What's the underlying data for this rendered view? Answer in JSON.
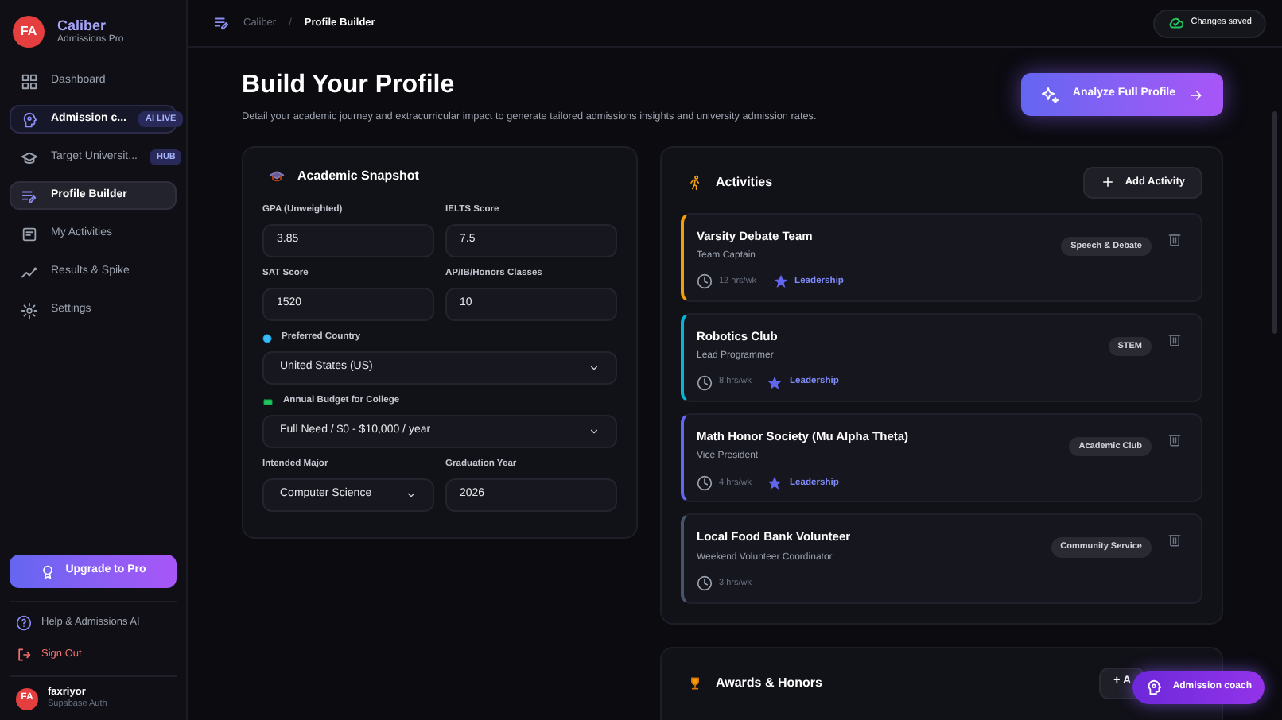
{
  "sidebar": {
    "brand": {
      "avatar": "FA",
      "name": "Caliber",
      "subtitle": "Admissions Pro"
    },
    "items": [
      {
        "label": "Dashboard",
        "selected": false,
        "highlighted": false
      },
      {
        "label": "Admission c...",
        "badge": "AI LIVE",
        "selected": false,
        "highlighted": true
      },
      {
        "label": "Target Universit...",
        "badge": "HUB",
        "selected": false,
        "highlighted": false
      },
      {
        "label": "Profile Builder",
        "selected": true,
        "highlighted": false
      },
      {
        "label": "My Activities",
        "selected": false,
        "highlighted": false
      },
      {
        "label": "Results & Spike",
        "selected": false,
        "highlighted": false
      },
      {
        "label": "Settings",
        "selected": false,
        "highlighted": false
      }
    ],
    "upgrade_button": "Upgrade to Pro",
    "help_link": "Help & Admissions AI",
    "sign_out": "Sign Out",
    "user": {
      "avatar": "FA",
      "name": "faxriyor",
      "subtitle": "Supabase Auth"
    }
  },
  "breadcrumb": [
    "Caliber",
    "Profile Builder"
  ],
  "breadcrumb_separator": "/",
  "save_status": "Changes saved",
  "page": {
    "title": "Build Your Profile",
    "subtitle": "Detail your academic journey and extracurricular impact to generate tailored admissions insights and university admission rates.",
    "analyze_button": "Analyze Full Profile"
  },
  "academic": {
    "title": "Academic Snapshot",
    "rows": [
      [
        {
          "label": "GPA (Unweighted)",
          "value": "3.85",
          "kind": "input"
        },
        {
          "label": "IELTS Score",
          "value": "7.5",
          "kind": "input"
        }
      ],
      [
        {
          "label": "SAT Score",
          "value": "1520",
          "kind": "input"
        },
        {
          "label": "AP/IB/Honors Classes",
          "value": "10",
          "kind": "input"
        }
      ],
      [
        {
          "label": "Preferred Country",
          "value": "United States (US)",
          "kind": "select"
        }
      ],
      [
        {
          "label": "Annual Budget for College",
          "value": "Full Need / $0 - $10,000 / year",
          "kind": "select"
        }
      ],
      [
        {
          "label": "Intended Major",
          "value": "Computer Science",
          "kind": "select"
        },
        {
          "label": "Graduation Year",
          "value": "2026",
          "kind": "input"
        }
      ]
    ]
  },
  "activities": {
    "title": "Activities",
    "add_button": "Add Activity",
    "items": [
      {
        "name": "Varsity Debate Team",
        "role": "Team Captain",
        "tag": "Speech & Debate",
        "hours": "12 hrs/wk",
        "highlight": "Leadership",
        "color": "#f59e0b"
      },
      {
        "name": "Robotics Club",
        "role": "Lead Programmer",
        "tag": "STEM",
        "hours": "8 hrs/wk",
        "highlight": "Leadership",
        "color": "#06b6d4"
      },
      {
        "name": "Math Honor Society (Mu Alpha Theta)",
        "role": "Vice President",
        "tag": "Academic Club",
        "hours": "4 hrs/wk",
        "highlight": "Leadership",
        "color": "#6366f1"
      },
      {
        "name": "Local Food Bank Volunteer",
        "role": "Weekend Volunteer Coordinator",
        "tag": "Community Service",
        "hours": "3 hrs/wk",
        "color": "#475569"
      }
    ]
  },
  "awards": {
    "title": "Awards & Honors",
    "add_button": "+ A"
  },
  "coach_button": "Admission coach"
}
